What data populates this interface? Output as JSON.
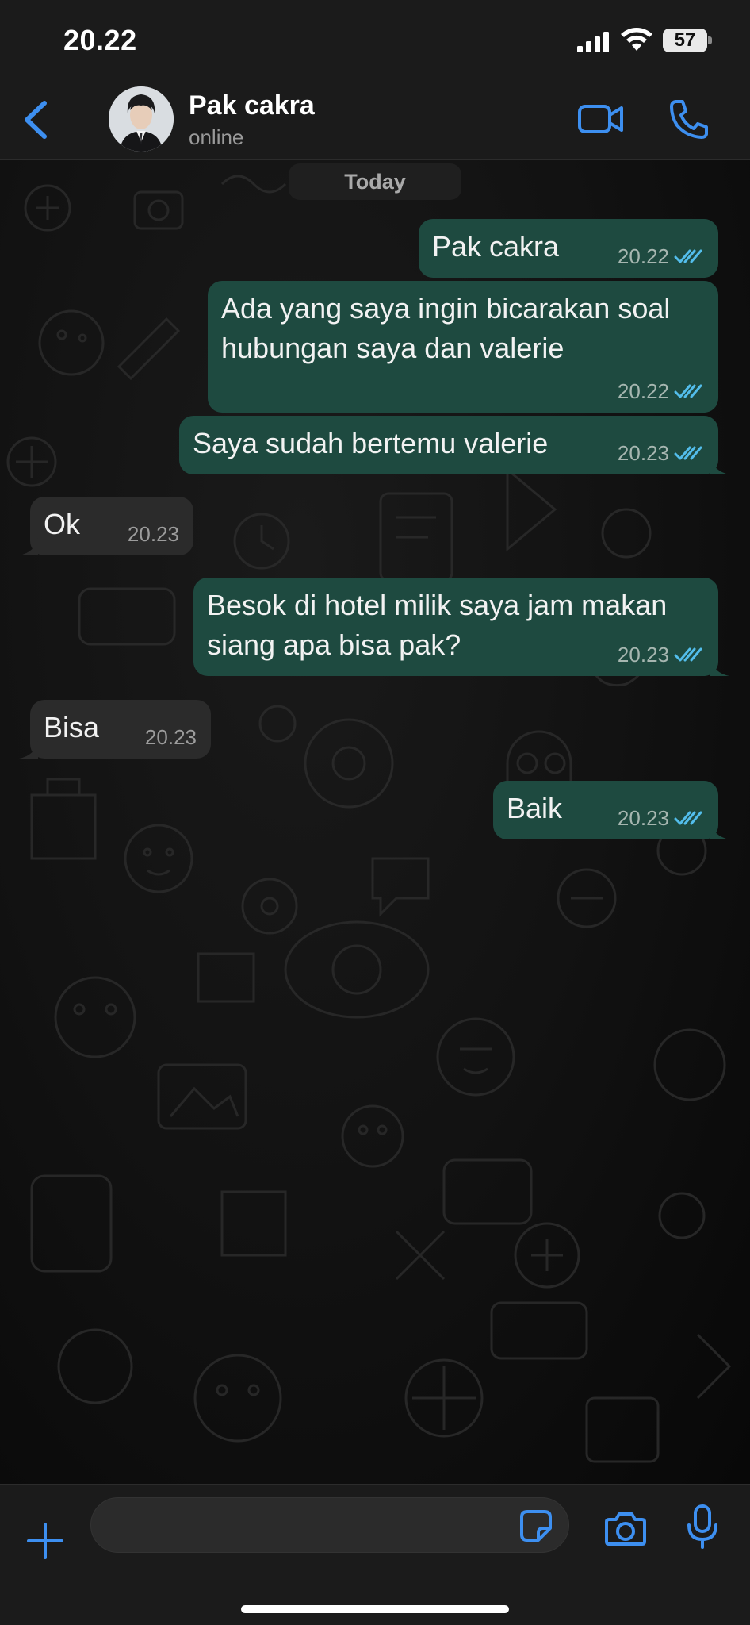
{
  "status_bar": {
    "time": "20.22",
    "battery": "57",
    "icons": [
      "cellular-signal-icon",
      "wifi-icon",
      "battery-icon"
    ]
  },
  "header": {
    "back_icon": "chevron-left-icon",
    "contact_name": "Pak cakra",
    "contact_status": "online",
    "video_icon": "video-camera-icon",
    "call_icon": "phone-icon"
  },
  "chat": {
    "date_separator": "Today",
    "messages": [
      {
        "direction": "outgoing",
        "text": "Pak cakra",
        "time": "20.22",
        "status": "read"
      },
      {
        "direction": "outgoing",
        "text": "Ada yang saya ingin bicarakan soal hubungan saya dan valerie",
        "lines": [
          "Ada yang saya ingin bicarakan soal",
          "hubungan saya dan valerie"
        ],
        "time": "20.22",
        "status": "read"
      },
      {
        "direction": "outgoing",
        "text": "Saya sudah bertemu valerie",
        "time": "20.23",
        "status": "read"
      },
      {
        "direction": "incoming",
        "text": "Ok",
        "time": "20.23"
      },
      {
        "direction": "outgoing",
        "text": "Besok di hotel milik saya jam makan siang apa bisa pak?",
        "lines": [
          "Besok di hotel milik saya jam makan",
          "siang apa bisa pak?"
        ],
        "time": "20.23",
        "status": "read"
      },
      {
        "direction": "incoming",
        "text": "Bisa",
        "time": "20.23"
      },
      {
        "direction": "outgoing",
        "text": "Baik",
        "time": "20.23",
        "status": "read"
      }
    ]
  },
  "input_bar": {
    "placeholder": "",
    "icons": [
      "plus-icon",
      "sticker-icon",
      "camera-icon",
      "microphone-icon"
    ]
  },
  "colors": {
    "accent": "#3d8ff0",
    "outgoing_bubble": "#1e4a40",
    "incoming_bubble": "#2b2b2b",
    "read_ticks": "#53bdeb",
    "background": "#0b0b0b"
  }
}
